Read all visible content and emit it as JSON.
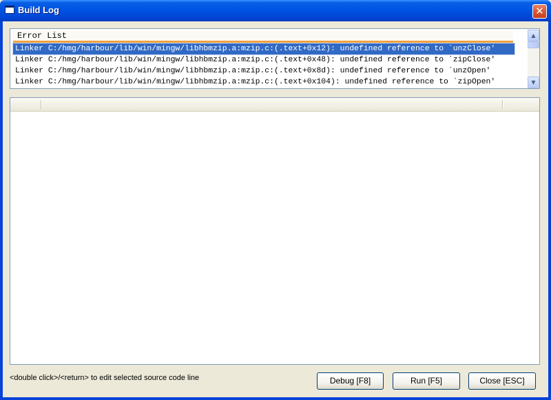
{
  "window": {
    "title": "Build Log",
    "close_glyph": "✕"
  },
  "error_list": {
    "header": "Error List",
    "rows": [
      "Linker C:/hmg/harbour/lib/win/mingw/libhbmzip.a:mzip.c:(.text+0x12): undefined reference to `unzClose'",
      "Linker C:/hmg/harbour/lib/win/mingw/libhbmzip.a:mzip.c:(.text+0x48): undefined reference to `zipClose'",
      "Linker C:/hmg/harbour/lib/win/mingw/libhbmzip.a:mzip.c:(.text+0x8d): undefined reference to `unzOpen'",
      "Linker C:/hmg/harbour/lib/win/mingw/libhbmzip.a:mzip.c:(.text+0x104): undefined reference to `zipOpen'"
    ],
    "selected_index": 0
  },
  "hint_text": "<double click>/<return> to edit selected source code line",
  "buttons": {
    "debug": "Debug [F8]",
    "run": "Run [F5]",
    "close": "Close [ESC]"
  },
  "icons": {
    "window_icon": "window-icon",
    "scroll_up": "chevron-up-icon",
    "scroll_down": "chevron-down-icon"
  },
  "colors": {
    "selection": "#316ac5",
    "titlebar": "#0054e3",
    "header_accent": "#f0a03c"
  }
}
